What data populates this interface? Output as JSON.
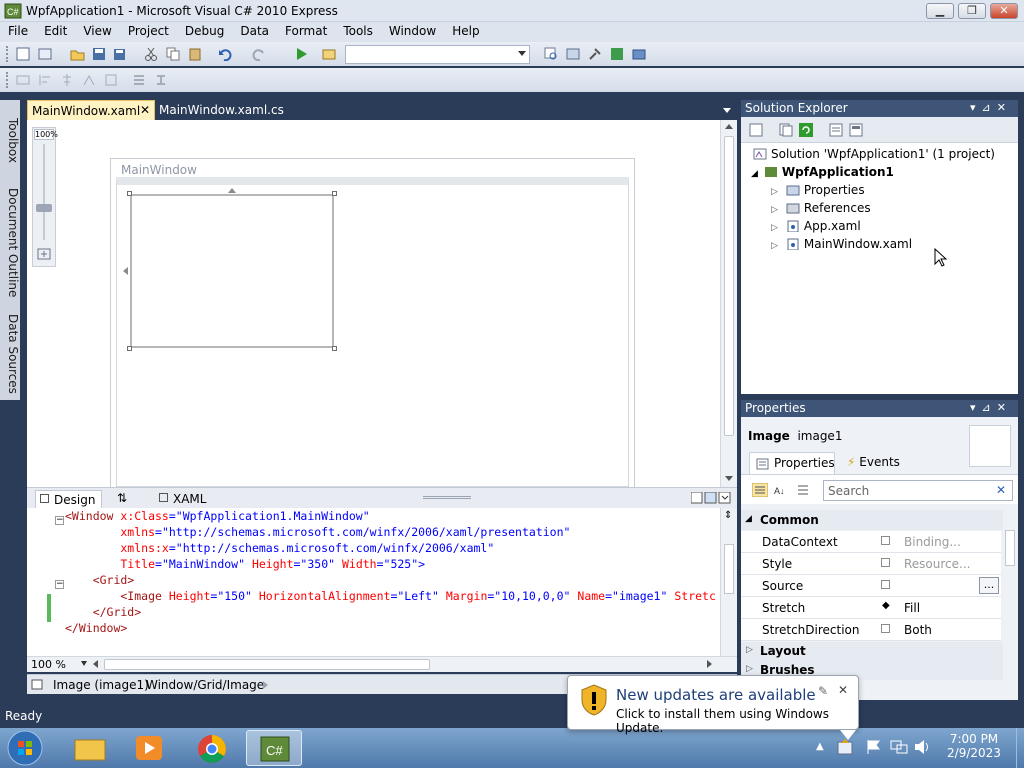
{
  "window": {
    "title": "WpfApplication1 - Microsoft Visual C# 2010 Express",
    "min": "▁",
    "max": "❐",
    "close": "✕"
  },
  "menu": [
    "File",
    "Edit",
    "View",
    "Project",
    "Debug",
    "Data",
    "Format",
    "Tools",
    "Window",
    "Help"
  ],
  "left_rail": {
    "toolbox": "Toolbox",
    "document_outline": "Document Outline",
    "data_sources": "Data Sources"
  },
  "doc_tabs": [
    {
      "label": "MainWindow.xaml",
      "active": true
    },
    {
      "label": "MainWindow.xaml.cs",
      "active": false
    }
  ],
  "designer": {
    "zoom_label": "100%",
    "window_title": "MainWindow"
  },
  "split": {
    "design_tab": "Design",
    "swap_icon": "swap-arrows-icon",
    "xaml_tab": "XAML"
  },
  "xaml_lines": [
    {
      "t": [
        [
          "kw",
          "<Window "
        ],
        [
          "at",
          "x:Class"
        ],
        [
          "bl",
          "=\"WpfApplication1.MainWindow\""
        ]
      ]
    },
    {
      "t": [
        [
          "at",
          "        xmlns"
        ],
        [
          "bl",
          "=\"http://schemas.microsoft.com/winfx/2006/xaml/presentation\""
        ]
      ]
    },
    {
      "t": [
        [
          "at",
          "        xmlns:x"
        ],
        [
          "bl",
          "=\"http://schemas.microsoft.com/winfx/2006/xaml\""
        ]
      ]
    },
    {
      "t": [
        [
          "at",
          "        Title"
        ],
        [
          "bl",
          "=\"MainWindow\" "
        ],
        [
          "at",
          "Height"
        ],
        [
          "bl",
          "=\"350\" "
        ],
        [
          "at",
          "Width"
        ],
        [
          "bl",
          "=\"525\">"
        ]
      ]
    },
    {
      "t": [
        [
          "kw",
          "    <Grid>"
        ]
      ]
    },
    {
      "t": [
        [
          "kw",
          "        <Image "
        ],
        [
          "at",
          "Height"
        ],
        [
          "bl",
          "=\"150\" "
        ],
        [
          "at",
          "HorizontalAlignment"
        ],
        [
          "bl",
          "=\"Left\" "
        ],
        [
          "at",
          "Margin"
        ],
        [
          "bl",
          "=\"10,10,0,0\" "
        ],
        [
          "at",
          "Name"
        ],
        [
          "bl",
          "=\"image1\" "
        ],
        [
          "at",
          "Stretc"
        ]
      ]
    },
    {
      "t": [
        [
          "kw",
          "    </Grid>"
        ]
      ]
    },
    {
      "t": [
        [
          "kw",
          "</Window>"
        ]
      ]
    }
  ],
  "editor": {
    "zoom": "100 %"
  },
  "breadcrumb": {
    "element": "Image (image1)",
    "path": "Window/Grid/Image"
  },
  "solution_explorer": {
    "title": "Solution Explorer",
    "solution": "Solution 'WpfApplication1' (1 project)",
    "project": "WpfApplication1",
    "items": [
      "Properties",
      "References",
      "App.xaml",
      "MainWindow.xaml"
    ]
  },
  "properties": {
    "title": "Properties",
    "element_type": "Image",
    "element_name": "image1",
    "tab_properties": "Properties",
    "tab_events": "Events",
    "search_placeholder": "Search",
    "category_common": "Common",
    "rows": [
      {
        "name": "DataContext",
        "value": "Binding...",
        "grey": true
      },
      {
        "name": "Style",
        "value": "Resource...",
        "grey": true
      },
      {
        "name": "Source",
        "value": "",
        "grey": false
      },
      {
        "name": "Stretch",
        "value": "Fill",
        "grey": false
      },
      {
        "name": "StretchDirection",
        "value": "Both",
        "grey": false
      }
    ],
    "category_layout": "Layout",
    "category_brushes": "Brushes",
    "ellipsis": "..."
  },
  "status": {
    "text": "Ready"
  },
  "notification": {
    "title": "New updates are available",
    "body": "Click to install them using Windows Update."
  },
  "clock": {
    "time": "7:00 PM",
    "date": "2/9/2023"
  },
  "colors": {
    "accent": "#3e5577",
    "workspace": "#2b3c59",
    "active_tab": "#fff3c4"
  }
}
